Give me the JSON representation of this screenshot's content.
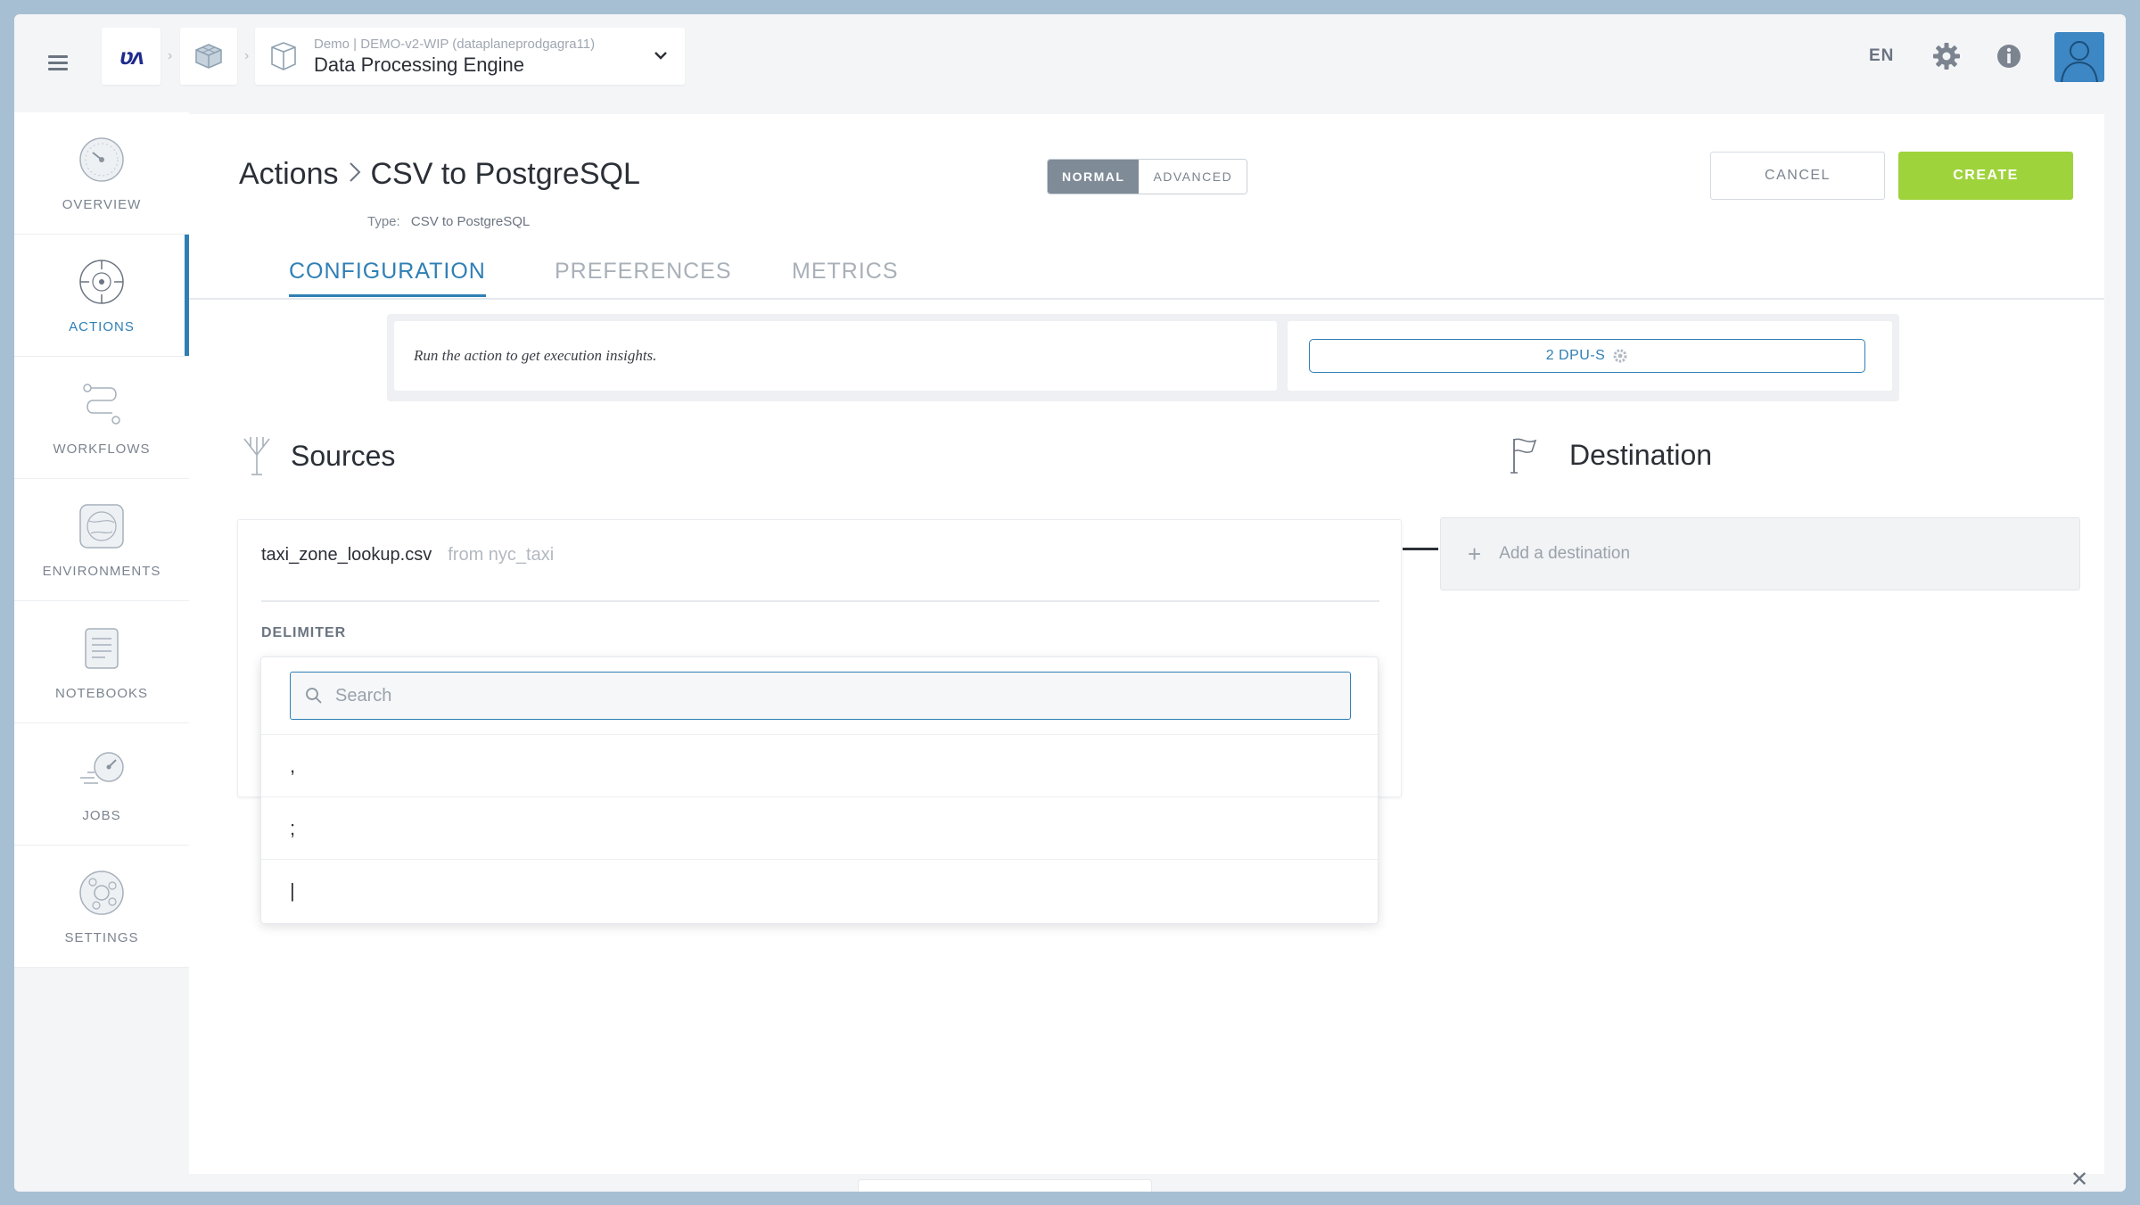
{
  "header": {
    "env_subtitle": "Demo | DEMO-v2-WIP (dataplaneprodgagra11)",
    "env_title": "Data Processing Engine",
    "language": "EN",
    "logo_text": "ʋʌ"
  },
  "sidebar": {
    "items": [
      {
        "label": "OVERVIEW",
        "icon": "gauge-icon",
        "active": false
      },
      {
        "label": "ACTIONS",
        "icon": "crosshair-icon",
        "active": true
      },
      {
        "label": "WORKFLOWS",
        "icon": "workflow-icon",
        "active": false
      },
      {
        "label": "ENVIRONMENTS",
        "icon": "globe-icon",
        "active": false
      },
      {
        "label": "NOTEBOOKS",
        "icon": "notebook-icon",
        "active": false
      },
      {
        "label": "JOBS",
        "icon": "speedometer-icon",
        "active": false
      },
      {
        "label": "SETTINGS",
        "icon": "gear-icon",
        "active": false
      }
    ]
  },
  "page": {
    "breadcrumb_root": "Actions",
    "breadcrumb_sep": ">",
    "title": "CSV to PostgreSQL",
    "type_label": "Type:",
    "type_value": "CSV to PostgreSQL",
    "mode": {
      "normal": "NORMAL",
      "advanced": "ADVANCED",
      "selected": "NORMAL"
    },
    "cancel_label": "CANCEL",
    "create_label": "CREATE",
    "tabs": [
      {
        "label": "CONFIGURATION",
        "active": true
      },
      {
        "label": "PREFERENCES",
        "active": false
      },
      {
        "label": "METRICS",
        "active": false
      }
    ]
  },
  "insights": {
    "message": "Run the action to get execution insights.",
    "dpu_label": "2 DPU-S"
  },
  "sources": {
    "title": "Sources",
    "file_name": "taxi_zone_lookup.csv",
    "from_text": "from nyc_taxi",
    "delimiter_label": "DELIMITER"
  },
  "destination": {
    "title": "Destination",
    "add_label": "Add a destination"
  },
  "dropdown": {
    "search_placeholder": "Search",
    "search_value": "",
    "options": [
      ",",
      ";",
      "|"
    ]
  },
  "colors": {
    "accent": "#2f7fb5",
    "create": "#9fd33b",
    "frame": "#a7bfd3"
  }
}
